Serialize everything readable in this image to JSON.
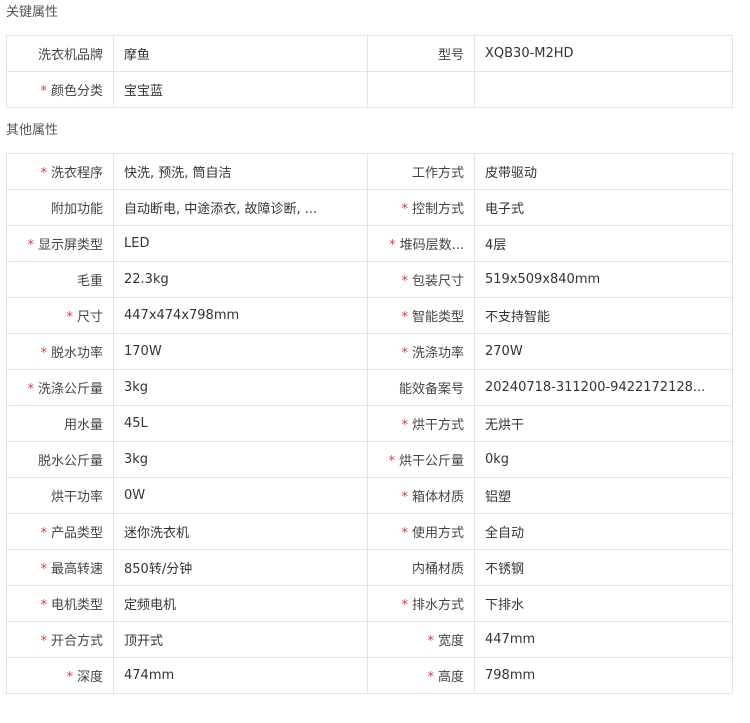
{
  "key_section": {
    "title": "关键属性",
    "rows": [
      [
        {
          "label": "洗衣机品牌",
          "required": false,
          "value": "摩鱼"
        },
        {
          "label": "型号",
          "required": false,
          "value": "XQB30-M2HD"
        }
      ],
      [
        {
          "label": "颜色分类",
          "required": true,
          "value": "宝宝蓝"
        },
        null
      ]
    ]
  },
  "other_section": {
    "title": "其他属性",
    "rows": [
      [
        {
          "label": "洗衣程序",
          "required": true,
          "value": "快洗, 预洗, 筒自洁"
        },
        {
          "label": "工作方式",
          "required": false,
          "value": "皮带驱动"
        }
      ],
      [
        {
          "label": "附加功能",
          "required": false,
          "value": "自动断电, 中途添衣, 故障诊断, ..."
        },
        {
          "label": "控制方式",
          "required": true,
          "value": "电子式"
        }
      ],
      [
        {
          "label": "显示屏类型",
          "required": true,
          "value": "LED"
        },
        {
          "label": "堆码层数...",
          "required": true,
          "value": "4层"
        }
      ],
      [
        {
          "label": "毛重",
          "required": false,
          "value": "22.3kg"
        },
        {
          "label": "包装尺寸",
          "required": true,
          "value": "519x509x840mm"
        }
      ],
      [
        {
          "label": "尺寸",
          "required": true,
          "value": "447x474x798mm"
        },
        {
          "label": "智能类型",
          "required": true,
          "value": "不支持智能"
        }
      ],
      [
        {
          "label": "脱水功率",
          "required": true,
          "value": "170W"
        },
        {
          "label": "洗涤功率",
          "required": true,
          "value": "270W"
        }
      ],
      [
        {
          "label": "洗涤公斤量",
          "required": true,
          "value": "3kg"
        },
        {
          "label": "能效备案号",
          "required": false,
          "value": "20240718-311200-9422172128..."
        }
      ],
      [
        {
          "label": "用水量",
          "required": false,
          "value": "45L"
        },
        {
          "label": "烘干方式",
          "required": true,
          "value": "无烘干"
        }
      ],
      [
        {
          "label": "脱水公斤量",
          "required": false,
          "value": "3kg"
        },
        {
          "label": "烘干公斤量",
          "required": true,
          "value": "0kg"
        }
      ],
      [
        {
          "label": "烘干功率",
          "required": false,
          "value": "0W"
        },
        {
          "label": "箱体材质",
          "required": true,
          "value": "铝塑"
        }
      ],
      [
        {
          "label": "产品类型",
          "required": true,
          "value": "迷你洗衣机"
        },
        {
          "label": "使用方式",
          "required": true,
          "value": "全自动"
        }
      ],
      [
        {
          "label": "最高转速",
          "required": true,
          "value": "850转/分钟"
        },
        {
          "label": "内桶材质",
          "required": false,
          "value": "不锈钢"
        }
      ],
      [
        {
          "label": "电机类型",
          "required": true,
          "value": "定频电机"
        },
        {
          "label": "排水方式",
          "required": true,
          "value": "下排水"
        }
      ],
      [
        {
          "label": "开合方式",
          "required": true,
          "value": "顶开式"
        },
        {
          "label": "宽度",
          "required": true,
          "value": "447mm"
        }
      ],
      [
        {
          "label": "深度",
          "required": true,
          "value": "474mm"
        },
        {
          "label": "高度",
          "required": true,
          "value": "798mm"
        }
      ]
    ]
  },
  "required_mark": "*",
  "colors": {
    "required_star": "#e4393c",
    "border": "#e3e3e3",
    "text": "#333333"
  }
}
